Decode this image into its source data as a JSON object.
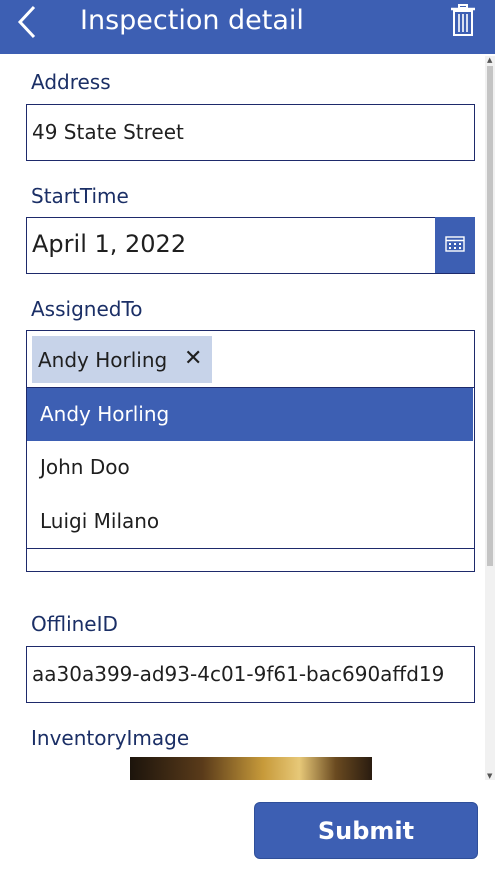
{
  "header": {
    "title": "Inspection detail",
    "back_icon": "chevron-left-icon",
    "delete_icon": "trash-icon"
  },
  "colors": {
    "accent": "#3d5fb3",
    "border": "#1e2a6b",
    "label": "#1b2f66",
    "chip": "#c7d3e9"
  },
  "form": {
    "address": {
      "label": "Address",
      "value": "49 State Street"
    },
    "start_time": {
      "label": "StartTime",
      "value": "April 1, 2022",
      "icon": "calendar-icon"
    },
    "assigned_to": {
      "label": "AssignedTo",
      "selected_chip": "Andy Horling",
      "remove_glyph": "✕",
      "options": [
        {
          "label": "Andy Horling",
          "selected": true
        },
        {
          "label": "John Doo",
          "selected": false
        },
        {
          "label": "Luigi Milano",
          "selected": false
        }
      ]
    },
    "offline_id": {
      "label": "OfflineID",
      "value": "aa30a399-ad93-4c01-9f61-bac690affd19"
    },
    "inventory_image": {
      "label": "InventoryImage"
    }
  },
  "actions": {
    "submit_label": "Submit"
  }
}
